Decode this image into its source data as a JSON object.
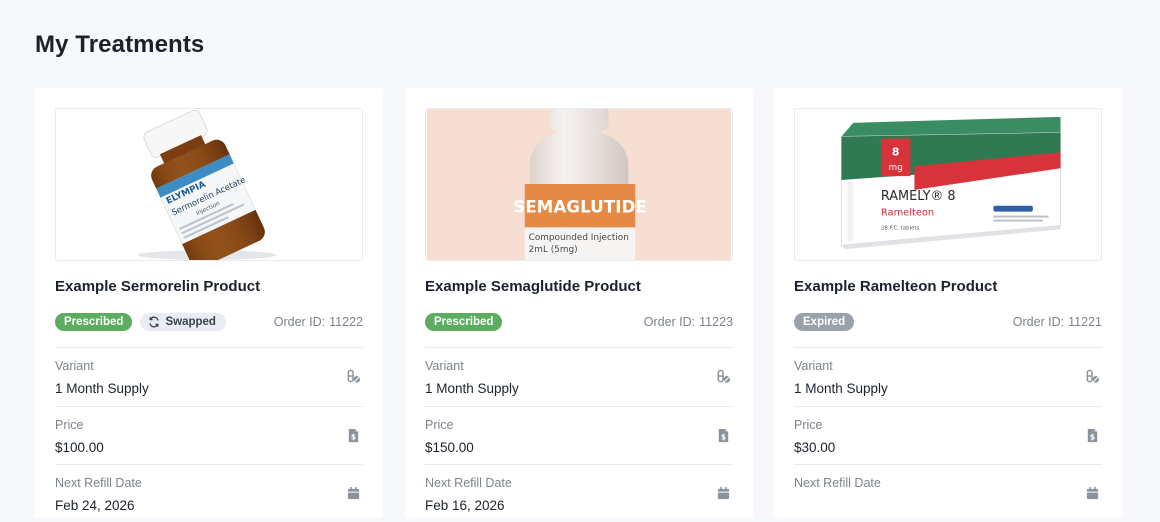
{
  "page": {
    "title": "My Treatments"
  },
  "cards": [
    {
      "product_name": "Example Sermorelin Product",
      "status": "Prescribed",
      "swapped_label": "Swapped",
      "order_label": "Order ID:",
      "order_id": "11222",
      "image_text": {
        "brand": "ELYMPIA",
        "name": "Sermorelin Acetate",
        "sub": "Injection"
      },
      "variant_label": "Variant",
      "variant_value": "1 Month Supply",
      "price_label": "Price",
      "price_value": "$100.00",
      "refill_label": "Next Refill Date",
      "refill_value": "Feb 24, 2026"
    },
    {
      "product_name": "Example Semaglutide Product",
      "status": "Prescribed",
      "order_label": "Order ID:",
      "order_id": "11223",
      "image_text": {
        "name": "SEMAGLUTIDE",
        "sub1": "Compounded Injection",
        "sub2": "2mL (5mg)"
      },
      "variant_label": "Variant",
      "variant_value": "1 Month Supply",
      "price_label": "Price",
      "price_value": "$150.00",
      "refill_label": "Next Refill Date",
      "refill_value": "Feb 16, 2026"
    },
    {
      "product_name": "Example Ramelteon Product",
      "status": "Expired",
      "order_label": "Order ID:",
      "order_id": "11221",
      "image_text": {
        "dose": "8",
        "unit": "mg",
        "brand": "RAMELY® 8",
        "name": "Ramelteon",
        "sub": "28 F.C. tablets"
      },
      "variant_label": "Variant",
      "variant_value": "1 Month Supply",
      "price_label": "Price",
      "price_value": "$30.00",
      "refill_label": "Next Refill Date",
      "refill_value": ""
    }
  ],
  "colors": {
    "prescribed": "#5cad5f",
    "expired": "#9aa1ab",
    "swapped_bg": "#e9edf2",
    "semaglutide_orange": "#e58a45",
    "ramelteon_green": "#2f7a53",
    "ramelteon_red": "#d8333a"
  },
  "icons": {
    "variant": "pills-icon",
    "price": "invoice-dollar-icon",
    "refill": "calendar-icon",
    "swapped": "swap-arrows-icon"
  }
}
